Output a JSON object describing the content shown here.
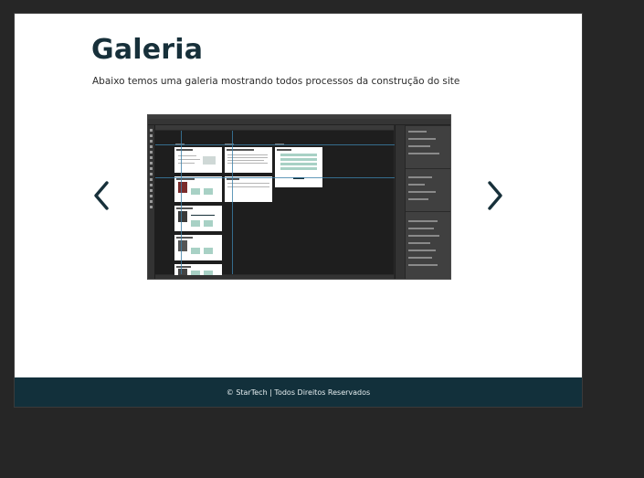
{
  "main": {
    "title": "Galeria",
    "subtitle": "Abaixo temos uma galeria mostrando todos processos da construção do site"
  },
  "gallery": {
    "prev_icon": "chevron-left-icon",
    "next_icon": "chevron-right-icon",
    "image_description": "Photoshop workspace screenshot"
  },
  "footer": {
    "text": "© StarTech | Todos Direitos Reservados"
  },
  "colors": {
    "heading": "#17303a",
    "footer_bg": "#12303b",
    "page_bg": "#ffffff",
    "backdrop": "#262626"
  }
}
